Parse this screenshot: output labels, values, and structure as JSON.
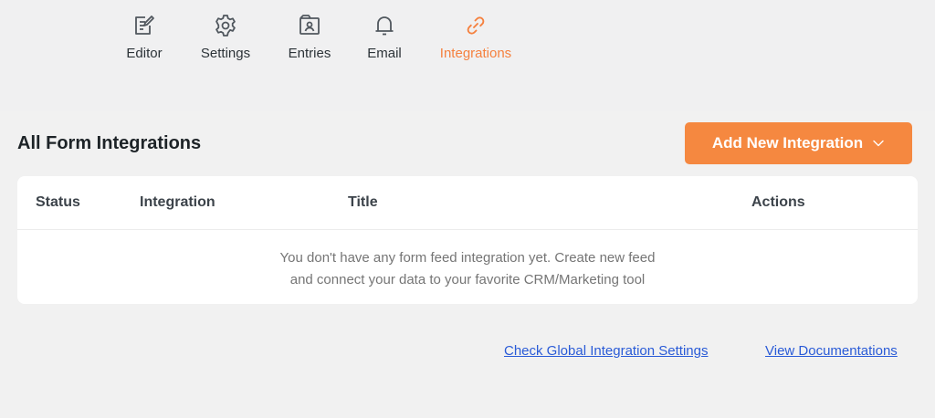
{
  "nav": {
    "items": [
      {
        "label": "Editor",
        "icon": "edit-icon"
      },
      {
        "label": "Settings",
        "icon": "gear-icon"
      },
      {
        "label": "Entries",
        "icon": "contact-card-icon"
      },
      {
        "label": "Email",
        "icon": "bell-icon"
      },
      {
        "label": "Integrations",
        "icon": "link-icon",
        "active": true
      }
    ],
    "active_color": "#f5813f"
  },
  "section": {
    "title": "All Form Integrations",
    "add_button_label": "Add New Integration",
    "accent_color": "#f58840"
  },
  "table": {
    "columns": [
      "Status",
      "Integration",
      "Title",
      "Actions"
    ],
    "empty_line1": "You don't have any form feed integration yet. Create new feed",
    "empty_line2": "and connect your data to your favorite CRM/Marketing tool"
  },
  "footer_links": {
    "global_settings": "Check Global Integration Settings",
    "documentation": "View Documentations"
  }
}
